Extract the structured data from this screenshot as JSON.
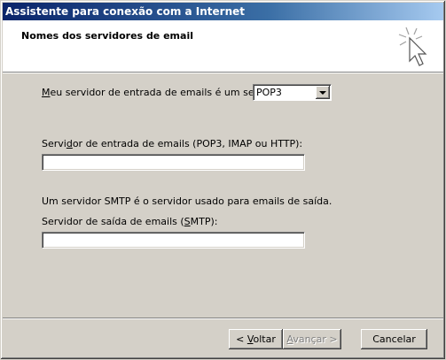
{
  "window": {
    "title": "Assistente para conexão com a Internet"
  },
  "header": {
    "title": "Nomes dos servidores de email"
  },
  "incoming_type": {
    "label_prefix": "",
    "label_mnemonic": "M",
    "label_rest": "eu servidor de entrada de emails é um  servidor",
    "selected": "POP3"
  },
  "incoming_server": {
    "label_prefix": "Servi",
    "label_mnemonic": "d",
    "label_rest": "or de entrada de emails (POP3, IMAP ou HTTP):",
    "value": ""
  },
  "smtp_info": "Um servidor SMTP é o servidor usado para emails de saída.",
  "outgoing_server": {
    "label_prefix": "Servidor de saída de emails (",
    "label_mnemonic": "S",
    "label_rest": "MTP):",
    "value": ""
  },
  "buttons": {
    "back_prefix": "< ",
    "back_mnemonic": "V",
    "back_rest": "oltar",
    "next_prefix": "",
    "next_mnemonic": "A",
    "next_rest": "vançar >",
    "cancel": "Cancelar"
  }
}
